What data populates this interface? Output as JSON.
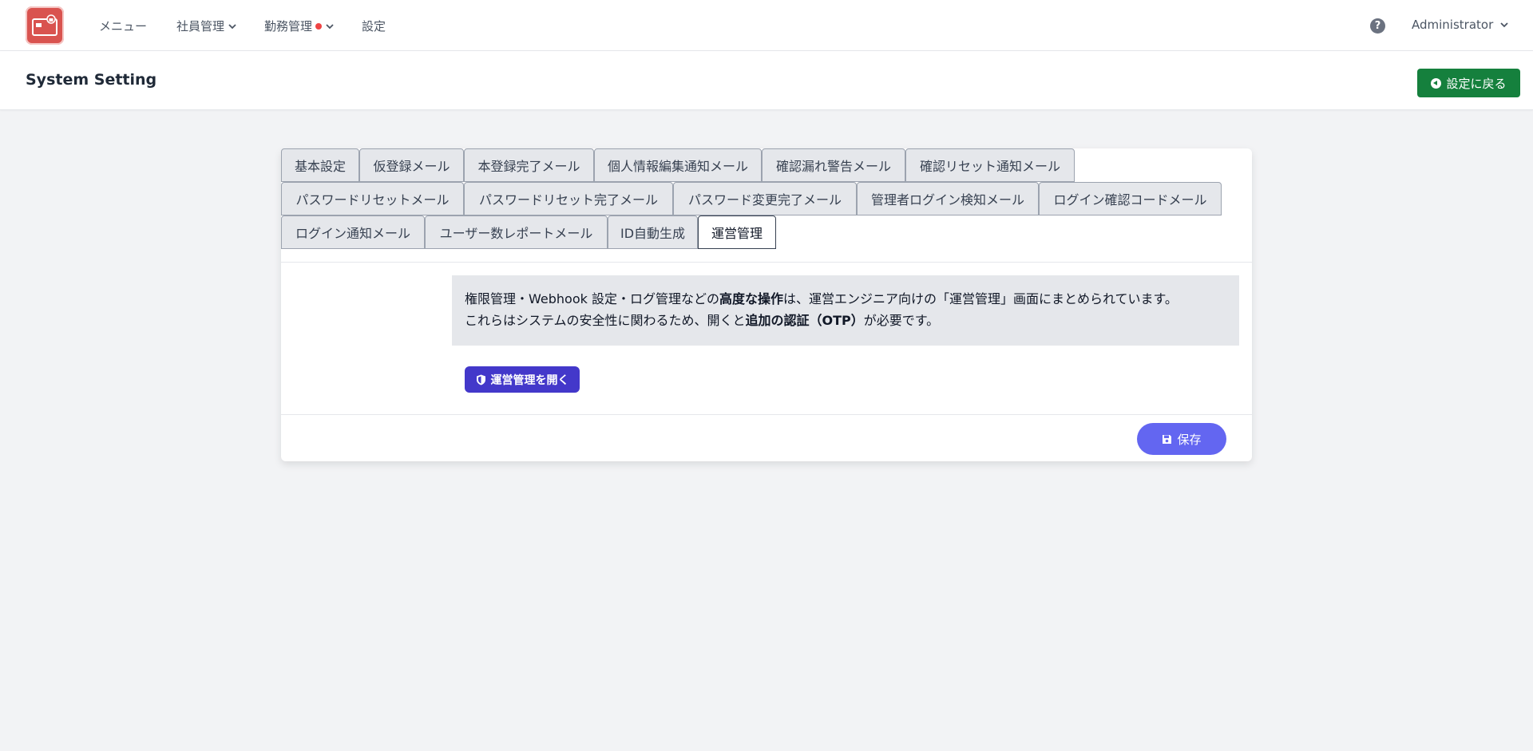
{
  "nav": {
    "items": [
      {
        "label": "メニュー"
      },
      {
        "label": "社員管理"
      },
      {
        "label": "勤務管理"
      },
      {
        "label": "設定"
      }
    ],
    "user": "Administrator"
  },
  "header": {
    "title": "System Setting",
    "back_label": "設定に戻る"
  },
  "tabs": {
    "row1": [
      "基本設定",
      "仮登録メール",
      "本登録完了メール",
      "個人情報編集通知メール",
      "確認漏れ警告メール",
      "確認リセット通知メール"
    ],
    "row2": [
      "パスワードリセットメール",
      "パスワードリセット完了メール",
      "パスワード変更完了メール",
      "管理者ログイン検知メール",
      "ログイン確認コードメール"
    ],
    "row3": [
      "ログイン通知メール",
      "ユーザー数レポートメール",
      "ID自動生成",
      "運営管理"
    ],
    "active": "運営管理"
  },
  "notice": {
    "line1_pre": "権限管理・Webhook 設定・ログ管理などの",
    "line1_bold": "高度な操作",
    "line1_post": "は、運営エンジニア向けの「運営管理」画面にまとめられています。",
    "line2_pre": "これらはシステムの安全性に関わるため、開くと",
    "line2_bold": "追加の認証（OTP）",
    "line2_post": "が必要です。"
  },
  "buttons": {
    "open_admin": "運営管理を開く",
    "save": "保存"
  },
  "colors": {
    "back_button": "#15803d",
    "open_button": "#4338ca",
    "save_button": "#6366f1",
    "logo": "#d9534f",
    "badge_dot": "#ef4444"
  }
}
